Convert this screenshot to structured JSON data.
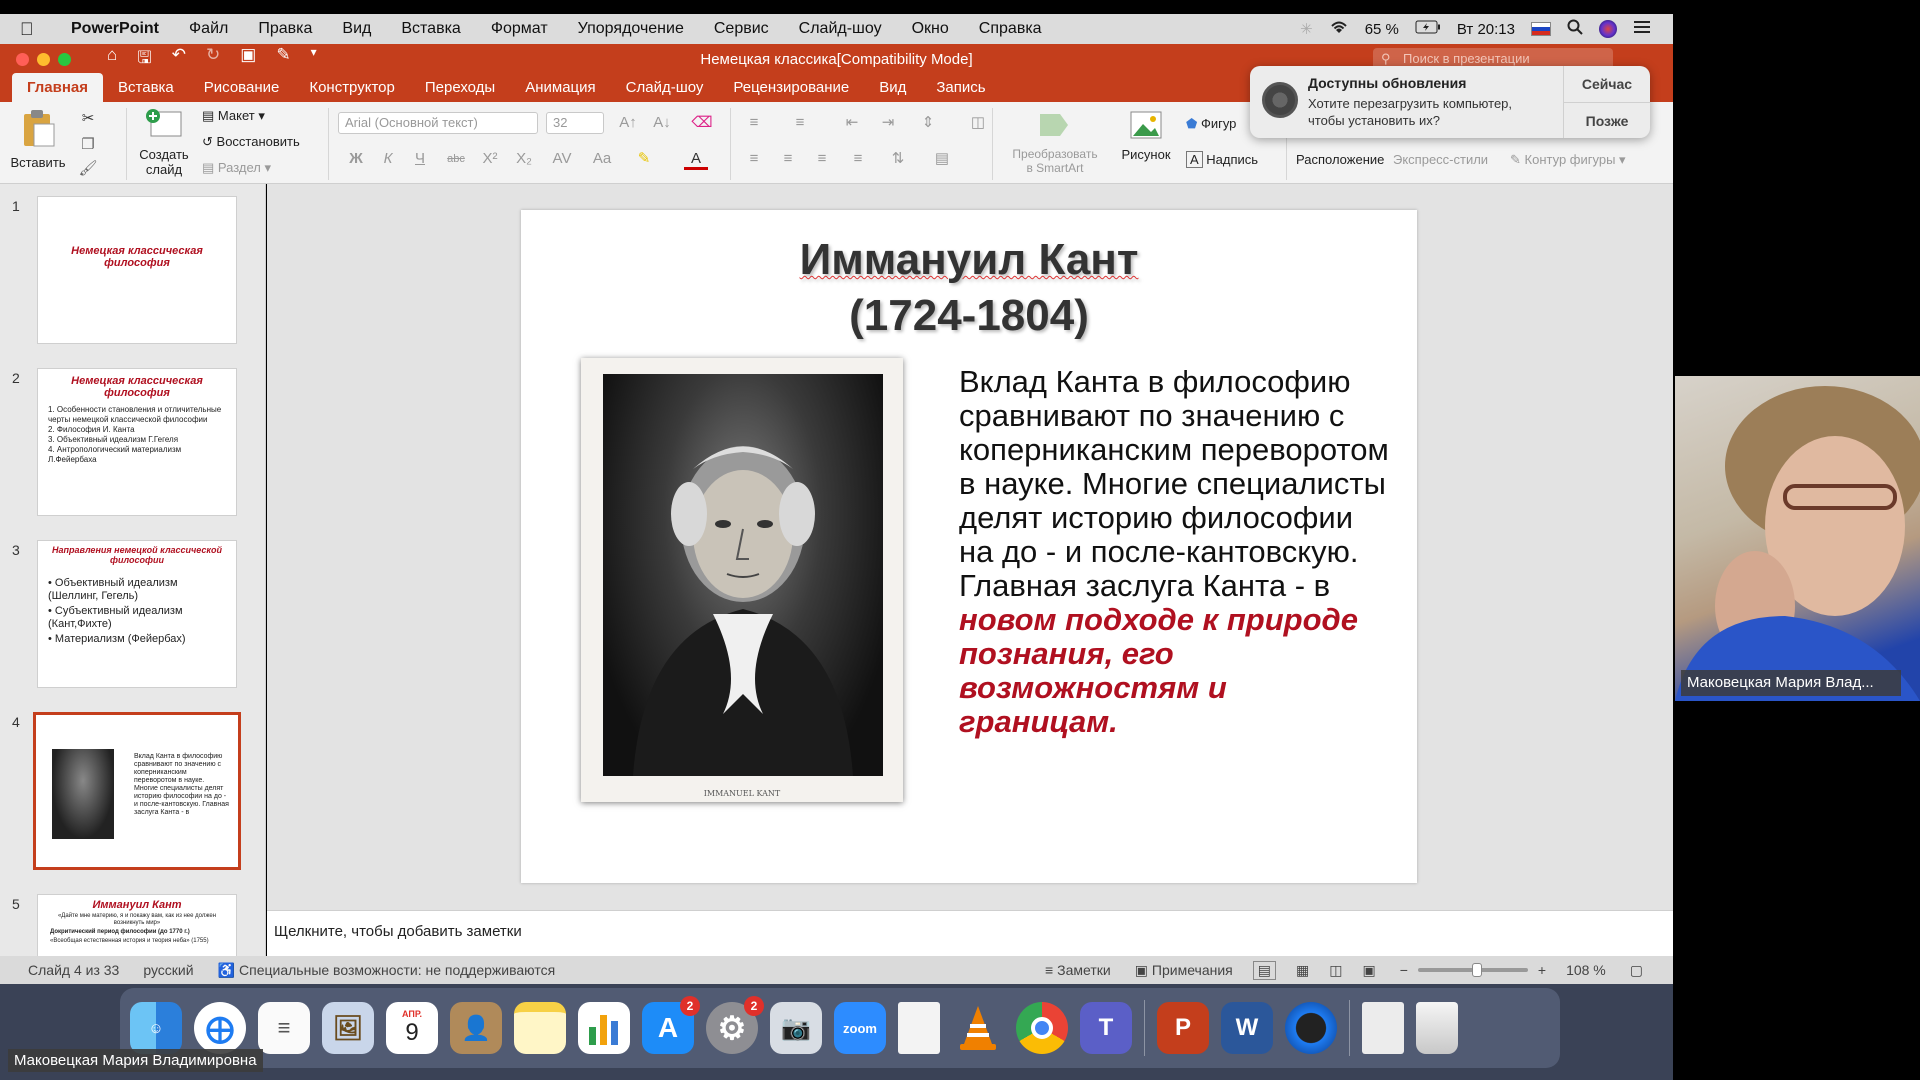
{
  "menubar": {
    "app": "PowerPoint",
    "items": [
      "Файл",
      "Правка",
      "Вид",
      "Вставка",
      "Формат",
      "Упорядочение",
      "Сервис",
      "Слайд-шоу",
      "Окно",
      "Справка"
    ],
    "battery": "65 %",
    "clock": "Вт 20:13"
  },
  "titlebar": {
    "document_title": "Немецкая классика[Compatibility Mode]",
    "search_placeholder": "Поиск в презентации"
  },
  "ribbon_tabs": [
    "Главная",
    "Вставка",
    "Рисование",
    "Конструктор",
    "Переходы",
    "Анимация",
    "Слайд-шоу",
    "Рецензирование",
    "Вид",
    "Запись"
  ],
  "ribbon": {
    "paste": "Вставить",
    "new_slide_line1": "Создать",
    "new_slide_line2": "слайд",
    "layout": "Макет",
    "reset": "Восстановить",
    "section": "Раздел",
    "font_name": "Arial (Основной текст)",
    "font_size": "32",
    "smartart_line1": "Преобразовать",
    "smartart_line2": "в SmartArt",
    "picture": "Рисунок",
    "shapes": "Фигур",
    "textbox": "Надпись",
    "arrange": "Расположение",
    "quick_styles": "Экспресс-стили",
    "shape_outline": "Контур фигуры"
  },
  "notification": {
    "title": "Доступны обновления",
    "body": "Хотите перезагрузить компьютер, чтобы установить их?",
    "btn_now": "Сейчас",
    "btn_later": "Позже"
  },
  "thumbnails": [
    {
      "num": "1",
      "title": "Немецкая классическая философия"
    },
    {
      "num": "2",
      "title": "Немецкая классическая философия",
      "items": [
        "1.   Особенности становления и отличительные черты немецкой классической философии",
        "2.   Философия И. Канта",
        "3.   Объективный идеализм Г.Гегеля",
        "4.   Антропологический материализм Л.Фейербаха"
      ]
    },
    {
      "num": "3",
      "title": "Направления немецкой классической философии",
      "items": [
        "• Объективный идеализм (Шеллинг, Гегель)",
        "• Субъективный идеализм (Кант,Фихте)",
        "• Материализм (Фейербах)"
      ]
    },
    {
      "num": "4"
    },
    {
      "num": "5",
      "title": "Иммануил Кант",
      "subtitle": "«Дайте мне материю, я и покажу вам, как из нее должен возникнуть мир»",
      "line1": "Докритический период философии (до 1770 г.)",
      "line2": "«Всеобщая естественная история и теория неба» (1755)"
    }
  ],
  "slide": {
    "title_name": "Иммануил Кант",
    "title_years": "(1724-1804)",
    "portrait_caption": "IMMANUEL KANT",
    "body": "Вклад Канта в философию сравнивают по значению с коперниканским переворотом в науке. Многие специалисты делят историю философии на до - и после-кантовскую. Главная заслуга Канта - в ",
    "body_emphasis": "новом подходе к природе познания, его возможностям и границам."
  },
  "notes_placeholder": "Щелкните, чтобы добавить заметки",
  "statusbar": {
    "slide_counter": "Слайд 4 из 33",
    "language": "русский",
    "accessibility": "Специальные возможности: не поддерживаются",
    "notes": "Заметки",
    "comments": "Примечания",
    "zoom": "108 %"
  },
  "dock": {
    "calendar_month": "АПР.",
    "calendar_day": "9",
    "appstore_badge": "2",
    "settings_badge": "2",
    "zoom_label": "zoom"
  },
  "video": {
    "participant_name": "Маковецкая Мария Влад...",
    "self_name": "Маковецкая Мария Владимировна"
  },
  "colors": {
    "accent": "#c43e1c",
    "emphasis_text": "#b01020"
  }
}
